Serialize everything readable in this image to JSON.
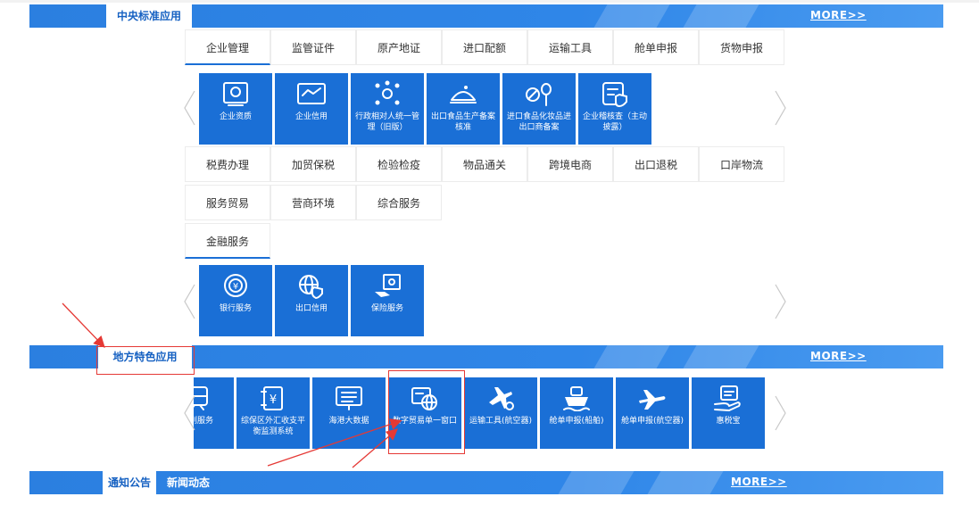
{
  "central": {
    "title": "中央标准应用",
    "more": "MORE>>",
    "row1_tabs": [
      "企业管理",
      "监管证件",
      "原产地证",
      "进口配额",
      "运输工具",
      "舱单申报",
      "货物申报"
    ],
    "row1_tiles": [
      {
        "label": "企业资质",
        "icon": "certificate-icon"
      },
      {
        "label": "企业信用",
        "icon": "handshake-icon"
      },
      {
        "label": "行政相对人统一管理（旧版）",
        "icon": "people-network-icon"
      },
      {
        "label": "出口食品生产备案核准",
        "icon": "food-icon"
      },
      {
        "label": "进口食品化妆品进出口商备案",
        "icon": "cosmetics-icon"
      },
      {
        "label": "企业稽核查（主动披露）",
        "icon": "audit-shield-icon"
      }
    ],
    "row2_tabs": [
      "税费办理",
      "加贸保税",
      "检验检疫",
      "物品通关",
      "跨境电商",
      "出口退税",
      "口岸物流"
    ],
    "row3_tabs": [
      "服务贸易",
      "营商环境",
      "综合服务"
    ],
    "row4_tabs": [
      "金融服务"
    ],
    "finance_tiles": [
      {
        "label": "银行服务",
        "icon": "bank-yuan-icon"
      },
      {
        "label": "出口信用",
        "icon": "globe-insurance-icon"
      },
      {
        "label": "保险服务",
        "icon": "safe-icon"
      }
    ]
  },
  "local": {
    "title": "地方特色应用",
    "more": "MORE>>",
    "tiles": [
      {
        "label": "班列服务",
        "icon": "train-icon"
      },
      {
        "label": "综保区外汇收支平衡监测系统",
        "icon": "ledger-yuan-icon"
      },
      {
        "label": "海港大数据",
        "icon": "screen-list-icon"
      },
      {
        "label": "数字贸易单一窗口",
        "icon": "digital-trade-icon"
      },
      {
        "label": "运输工具(航空器)",
        "icon": "plane-up-icon"
      },
      {
        "label": "舱单申报(船舶)",
        "icon": "ship-icon"
      },
      {
        "label": "舱单申报(航空器)",
        "icon": "plane-icon"
      },
      {
        "label": "惠税宝",
        "icon": "hand-doc-icon"
      }
    ]
  },
  "notice": {
    "tab_active": "通知公告",
    "tab_other": "新闻动态",
    "more": "MORE>>"
  },
  "colors": {
    "brand_blue": "#1a6fd6",
    "band_blue": "#2f86e8",
    "highlight_red": "#e53935"
  }
}
